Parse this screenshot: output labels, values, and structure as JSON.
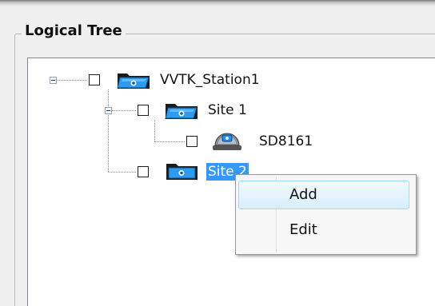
{
  "groupbox": {
    "title": "Logical Tree"
  },
  "tree": {
    "root": {
      "label": "VVTK_Station1",
      "expanded": true,
      "checked": false,
      "icon": "open-folder-icon"
    },
    "site1": {
      "label": "Site 1",
      "expanded": true,
      "checked": false,
      "icon": "open-folder-icon"
    },
    "device": {
      "label": "SD8161",
      "checked": false,
      "icon": "dome-camera-icon"
    },
    "site2": {
      "label": "Site 2",
      "selected": true,
      "checked": false,
      "icon": "closed-folder-icon"
    }
  },
  "context_menu": {
    "items": [
      {
        "label": "Add",
        "highlighted": true
      },
      {
        "label": "Edit",
        "highlighted": false
      }
    ]
  },
  "colors": {
    "selection": "#3399ff",
    "menu_hover_border": "#a8d8f5",
    "folder_blue": "#1e90ff"
  }
}
